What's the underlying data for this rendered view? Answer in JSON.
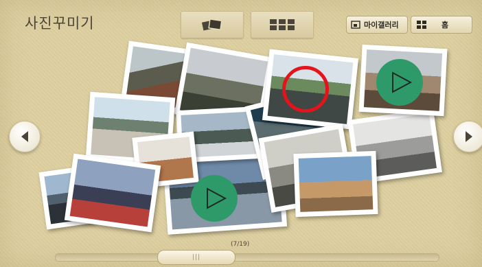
{
  "header": {
    "title": "사진꾸미기",
    "view_pile_icon": "photo-pile-icon",
    "view_grid_icon": "grid-view-icon",
    "my_gallery_label": "마이갤러리",
    "home_label": "홈"
  },
  "gallery": {
    "counter": "(7/19)",
    "current_index": 7,
    "total": 19,
    "scroll_thumb_glyph": "|||"
  },
  "colors": {
    "background": "#ddd0a2",
    "play_button": "#2e9a6a",
    "highlight_ring": "#e3141b"
  }
}
